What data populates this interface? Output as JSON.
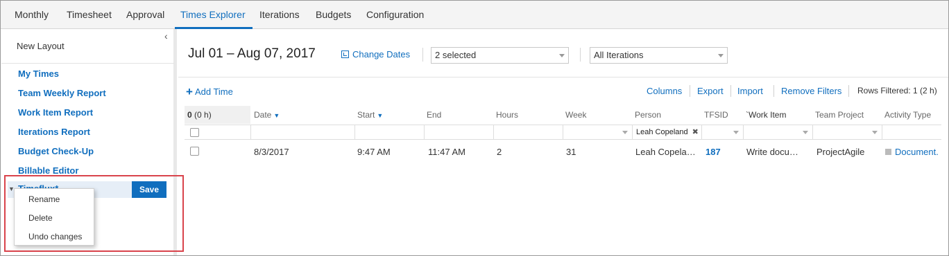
{
  "topnav": {
    "tabs": [
      {
        "label": "Monthly"
      },
      {
        "label": "Timesheet"
      },
      {
        "label": "Approval"
      },
      {
        "label": "Times Explorer"
      },
      {
        "label": "Iterations"
      },
      {
        "label": "Budgets"
      },
      {
        "label": "Configuration"
      }
    ],
    "active_tab": "Times Explorer"
  },
  "sidebar": {
    "collapse_glyph": "‹",
    "new_layout": "New Layout",
    "items": [
      {
        "label": "My Times"
      },
      {
        "label": "Team Weekly Report"
      },
      {
        "label": "Work Item Report"
      },
      {
        "label": "Iterations Report"
      },
      {
        "label": "Budget Check-Up"
      },
      {
        "label": "Billable Editor"
      }
    ],
    "selected_layout": {
      "name": "Timeflux*",
      "caret": "▼"
    },
    "save_label": "Save",
    "context_menu": {
      "items": [
        {
          "label": "Rename"
        },
        {
          "label": "Delete"
        },
        {
          "label": "Undo changes"
        }
      ]
    }
  },
  "main": {
    "date_range": "Jul 01 – Aug 07, 2017",
    "change_dates_label": "Change Dates",
    "project_select": {
      "value": "2 selected"
    },
    "iteration_select": {
      "value": "All Iterations"
    },
    "add_time_label": "Add Time",
    "add_time_glyph": "+",
    "toolbar": {
      "columns": "Columns",
      "export": "Export",
      "import": "Import",
      "remove_filters": "Remove Filters",
      "rows_filtered": "Rows Filtered: 1 (2 h)"
    },
    "grid": {
      "selection_count": "0",
      "selection_hours": "(0 h)",
      "sort_glyph": "▼",
      "columns": [
        "Date",
        "Start",
        "End",
        "Hours",
        "Week",
        "Person",
        "TFSID",
        "`Work Item",
        "Team Project",
        "Activity Type"
      ],
      "person_filter": "Leah Copeland",
      "clear_glyph": "✖",
      "rows": [
        {
          "date": "8/3/2017",
          "start": "9:47 AM",
          "end": "11:47 AM",
          "hours": "2",
          "week": "31",
          "person": "Leah Copela…",
          "tfsid": "187",
          "work_item": "Write docu…",
          "team_project": "ProjectAgile",
          "activity_type": "Document."
        }
      ]
    }
  },
  "colors": {
    "accent": "#106ebe",
    "highlight_box": "#d9434b",
    "selected_row_bg": "#e6eef7"
  },
  "icons": {
    "change_dates": "calendar-refresh-icon",
    "add_time": "plus-icon",
    "dropdown": "chevron-down-icon",
    "collapse": "chevron-left-icon"
  }
}
